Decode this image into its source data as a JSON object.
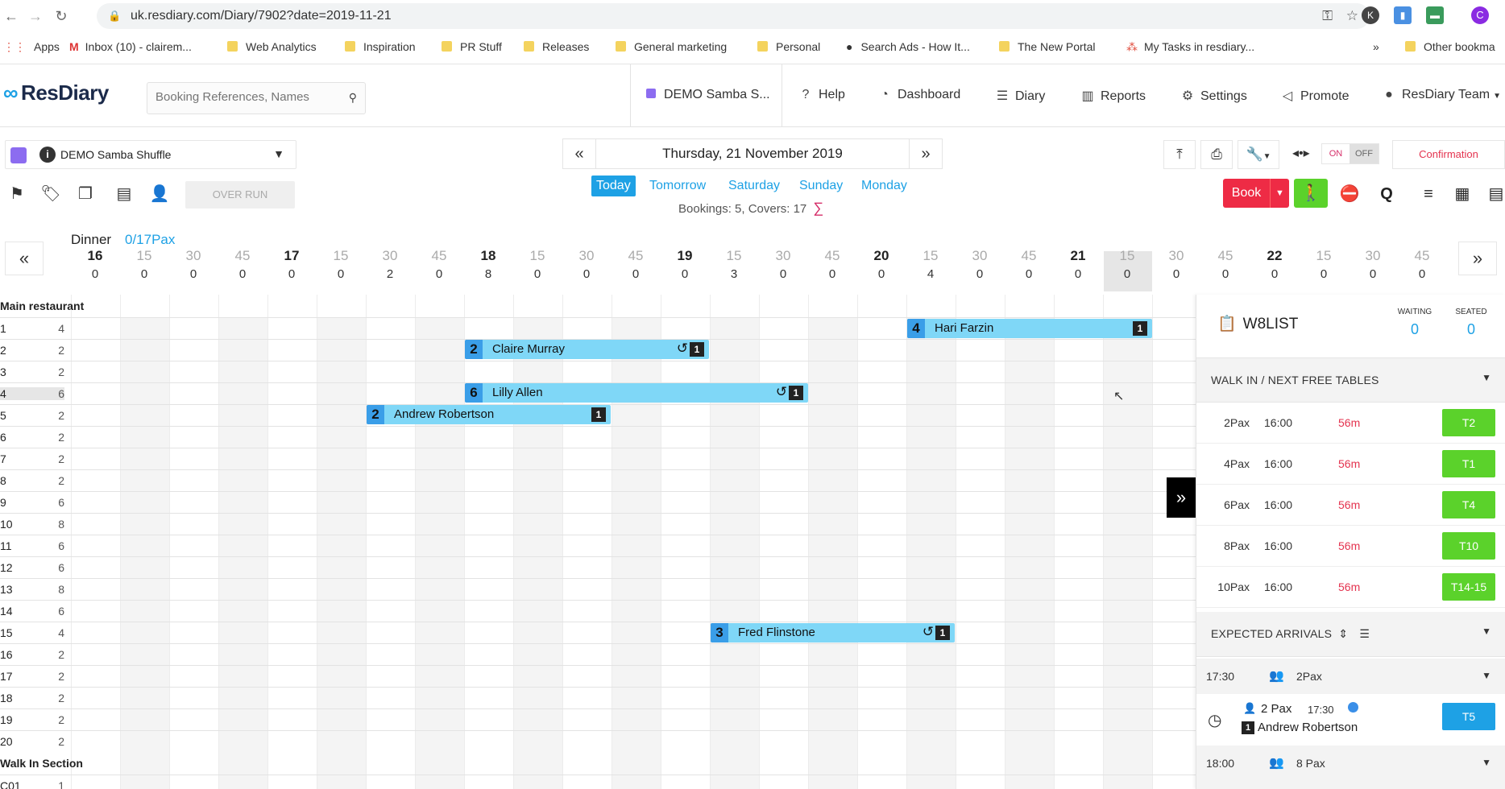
{
  "browser": {
    "url": "uk.resdiary.com/Diary/7902?date=2019-11-21",
    "profile_initial": "C",
    "ext_initial": "K",
    "bookmarks": [
      "Apps",
      "Inbox (10) - clairem...",
      "Web Analytics",
      "Inspiration",
      "PR Stuff",
      "Releases",
      "General marketing",
      "Personal",
      "Search Ads - How It...",
      "The New Portal",
      "My Tasks in resdiary...",
      "Other bookma"
    ]
  },
  "header": {
    "logo": "ResDiary",
    "search_placeholder": "Booking References, Names",
    "restaurant_short": "DEMO Samba S...",
    "nav": [
      "Help",
      "Dashboard",
      "Diary",
      "Reports",
      "Settings",
      "Promote",
      "ResDiary Team"
    ]
  },
  "toolbar": {
    "restaurant": "DEMO Samba Shuffle",
    "overrun": "OVER RUN",
    "date": "Thursday, 21 November 2019",
    "quick_days": [
      "Today",
      "Tomorrow",
      "Saturday",
      "Sunday",
      "Monday"
    ],
    "bookings_summary": "Bookings: 5, Covers: 17",
    "on": "ON",
    "off": "OFF",
    "confirmation": "Confirmation",
    "book": "Book",
    "q": "Q"
  },
  "timeline": {
    "shift": "Dinner",
    "pax": "0/17Pax",
    "columns": [
      {
        "label": "16",
        "count": "0"
      },
      {
        "label": "15",
        "count": "0"
      },
      {
        "label": "30",
        "count": "0"
      },
      {
        "label": "45",
        "count": "0"
      },
      {
        "label": "17",
        "count": "0"
      },
      {
        "label": "15",
        "count": "0"
      },
      {
        "label": "30",
        "count": "2"
      },
      {
        "label": "45",
        "count": "0"
      },
      {
        "label": "18",
        "count": "8"
      },
      {
        "label": "15",
        "count": "0"
      },
      {
        "label": "30",
        "count": "0"
      },
      {
        "label": "45",
        "count": "0"
      },
      {
        "label": "19",
        "count": "0"
      },
      {
        "label": "15",
        "count": "3"
      },
      {
        "label": "30",
        "count": "0"
      },
      {
        "label": "45",
        "count": "0"
      },
      {
        "label": "20",
        "count": "0"
      },
      {
        "label": "15",
        "count": "4"
      },
      {
        "label": "30",
        "count": "0"
      },
      {
        "label": "45",
        "count": "0"
      },
      {
        "label": "21",
        "count": "0"
      },
      {
        "label": "15",
        "count": "0"
      },
      {
        "label": "30",
        "count": "0"
      },
      {
        "label": "45",
        "count": "0"
      },
      {
        "label": "22",
        "count": "0"
      },
      {
        "label": "15",
        "count": "0"
      },
      {
        "label": "30",
        "count": "0"
      },
      {
        "label": "45",
        "count": "0"
      }
    ]
  },
  "grid": {
    "section_main": "Main restaurant",
    "section_walkin": "Walk In Section",
    "tables": [
      {
        "t": "1",
        "c": "4"
      },
      {
        "t": "2",
        "c": "2"
      },
      {
        "t": "3",
        "c": "2"
      },
      {
        "t": "4",
        "c": "6"
      },
      {
        "t": "5",
        "c": "2"
      },
      {
        "t": "6",
        "c": "2"
      },
      {
        "t": "7",
        "c": "2"
      },
      {
        "t": "8",
        "c": "2"
      },
      {
        "t": "9",
        "c": "6"
      },
      {
        "t": "10",
        "c": "8"
      },
      {
        "t": "11",
        "c": "6"
      },
      {
        "t": "12",
        "c": "6"
      },
      {
        "t": "13",
        "c": "8"
      },
      {
        "t": "14",
        "c": "6"
      },
      {
        "t": "15",
        "c": "4"
      },
      {
        "t": "16",
        "c": "2"
      },
      {
        "t": "17",
        "c": "2"
      },
      {
        "t": "18",
        "c": "2"
      },
      {
        "t": "19",
        "c": "2"
      },
      {
        "t": "20",
        "c": "2"
      }
    ],
    "walkin_tables": [
      {
        "t": "C01",
        "c": "1"
      }
    ],
    "bookings": [
      {
        "covers": "4",
        "name": "Hari Farzin",
        "tag": "1"
      },
      {
        "covers": "2",
        "name": "Claire Murray",
        "tag": "1"
      },
      {
        "covers": "6",
        "name": "Lilly Allen",
        "tag": "1"
      },
      {
        "covers": "2",
        "name": "Andrew Robertson",
        "tag": "1"
      },
      {
        "covers": "3",
        "name": "Fred Flinstone",
        "tag": "1"
      }
    ]
  },
  "waitlist": {
    "title": "W8LIST",
    "waiting_label": "WAITING",
    "waiting": "0",
    "seated_label": "SEATED",
    "seated": "0",
    "walkin_title": "WALK IN / NEXT FREE TABLES",
    "free_tables": [
      {
        "pax": "2Pax",
        "time": "16:00",
        "dur": "56m",
        "table": "T2"
      },
      {
        "pax": "4Pax",
        "time": "16:00",
        "dur": "56m",
        "table": "T1"
      },
      {
        "pax": "6Pax",
        "time": "16:00",
        "dur": "56m",
        "table": "T4"
      },
      {
        "pax": "8Pax",
        "time": "16:00",
        "dur": "56m",
        "table": "T10"
      },
      {
        "pax": "10Pax",
        "time": "16:00",
        "dur": "56m",
        "table": "T14-15"
      }
    ],
    "arrivals_title": "EXPECTED ARRIVALS",
    "arrivals": [
      {
        "time": "17:30",
        "pax": "2Pax"
      },
      {
        "time": "18:00",
        "pax": "8 Pax"
      }
    ],
    "arrival_booking": {
      "pax": "2 Pax",
      "time": "17:30",
      "tag": "1",
      "name": "Andrew Robertson",
      "table": "T5"
    }
  }
}
